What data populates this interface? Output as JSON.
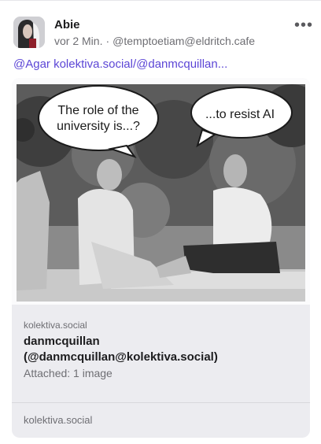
{
  "post": {
    "author_name": "Abie",
    "time_ago": "vor 2 Min.",
    "separator": "·",
    "handle": "@temptoetiam@eldritch.cafe",
    "more_label": "•••",
    "content_mention": "@Agar kolektiva.social/@danmcquillan..."
  },
  "card": {
    "image": {
      "bubble_left_line1": "The role of the",
      "bubble_left_line2": "university is...?",
      "bubble_right": "...to resist AI"
    },
    "domain": "kolektiva.social",
    "title_line1": "danmcquillan",
    "title_line2": "(@danmcquillan@kolektiva.social)",
    "description": "Attached: 1 image",
    "footer_domain": "kolektiva.social"
  },
  "icons": {
    "more": "more-dots-icon",
    "avatar": "user-avatar-photo"
  }
}
